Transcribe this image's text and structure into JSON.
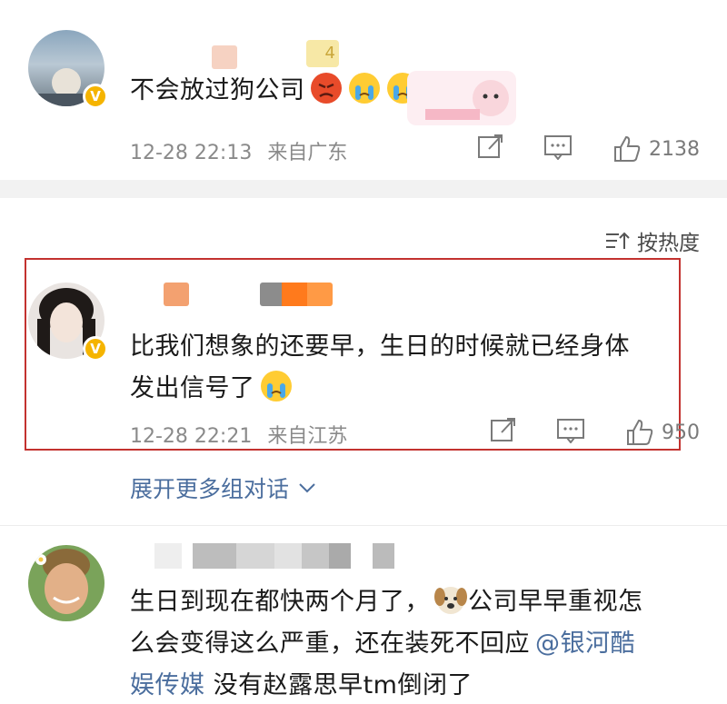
{
  "comments": [
    {
      "text": "不会放过狗公司",
      "time": "12-28 22:13",
      "location": "来自广东",
      "likes": "2138",
      "badge": "4"
    },
    {
      "line1": "比我们想象的还要早，生日的时候就已经身体",
      "line2": "发出信号了",
      "time": "12-28 22:21",
      "location": "来自江苏",
      "likes": "950"
    },
    {
      "line1": "生日到现在都快两个月了，",
      "line1b": "公司早早重视怎",
      "line2a": "么会变得这么严重，还在装死不回应",
      "mention1": "@银河酷",
      "mention2": "娱传媒",
      "line3": " 没有赵露思早tm倒闭了"
    }
  ],
  "sort_label": "按热度",
  "expand_label": "展开更多组对话",
  "colors": {
    "highlight": "#c3322f",
    "link": "#4b6e9e",
    "verified": "#f5b400"
  },
  "icons": [
    "share-icon",
    "comment-icon",
    "like-icon",
    "sort-icon",
    "chevron-down-icon",
    "verified-icon"
  ]
}
